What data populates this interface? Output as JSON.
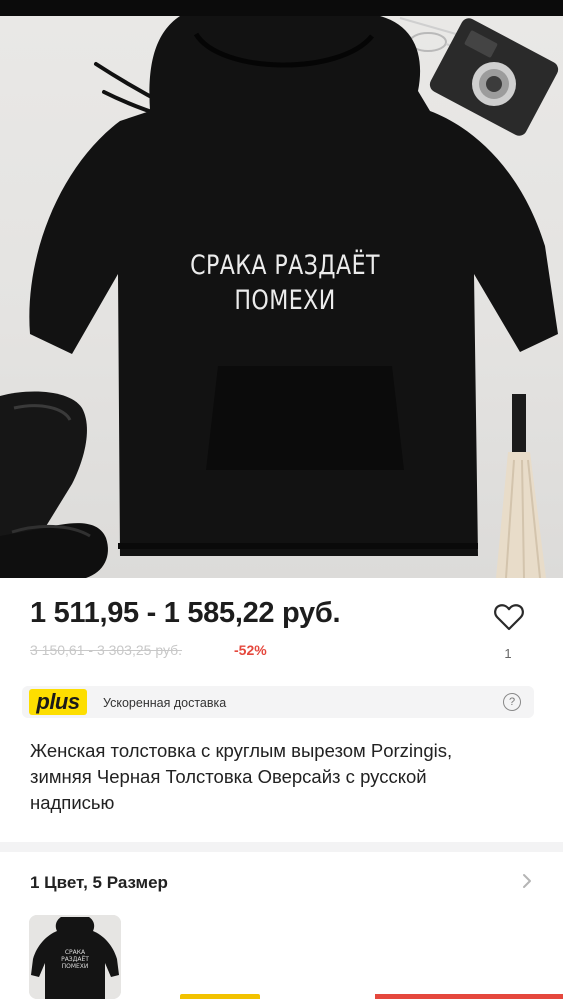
{
  "product": {
    "image_print_line1": "СРАКА РАЗДАЁТ",
    "image_print_line2": "ПОМЕХИ",
    "price_range": "1 511,95 - 1 585,22 руб.",
    "old_price_range": "3 150,61 - 3 303,25 руб.",
    "discount": "-52%",
    "favorites_count": "1",
    "title": "Женская толстовка с круглым вырезом Porzingis, зимняя Черная Толстовка Оверсайз с русской надписью"
  },
  "plus_banner": {
    "logo": "plus",
    "text": "Ускоренная доставка",
    "help_glyph": "?"
  },
  "variants": {
    "label": "1 Цвет, 5 Размер",
    "thumb_print": "СРАКА РАЗДАЁТ ПОМЕХИ"
  },
  "icons": {
    "favorite": "heart-outline-icon",
    "help": "question-circle-icon",
    "more": "chevron-right-icon"
  },
  "colors": {
    "accent_red": "#e5483d",
    "plus_yellow": "#fdde00",
    "hoodie": "#121212"
  }
}
